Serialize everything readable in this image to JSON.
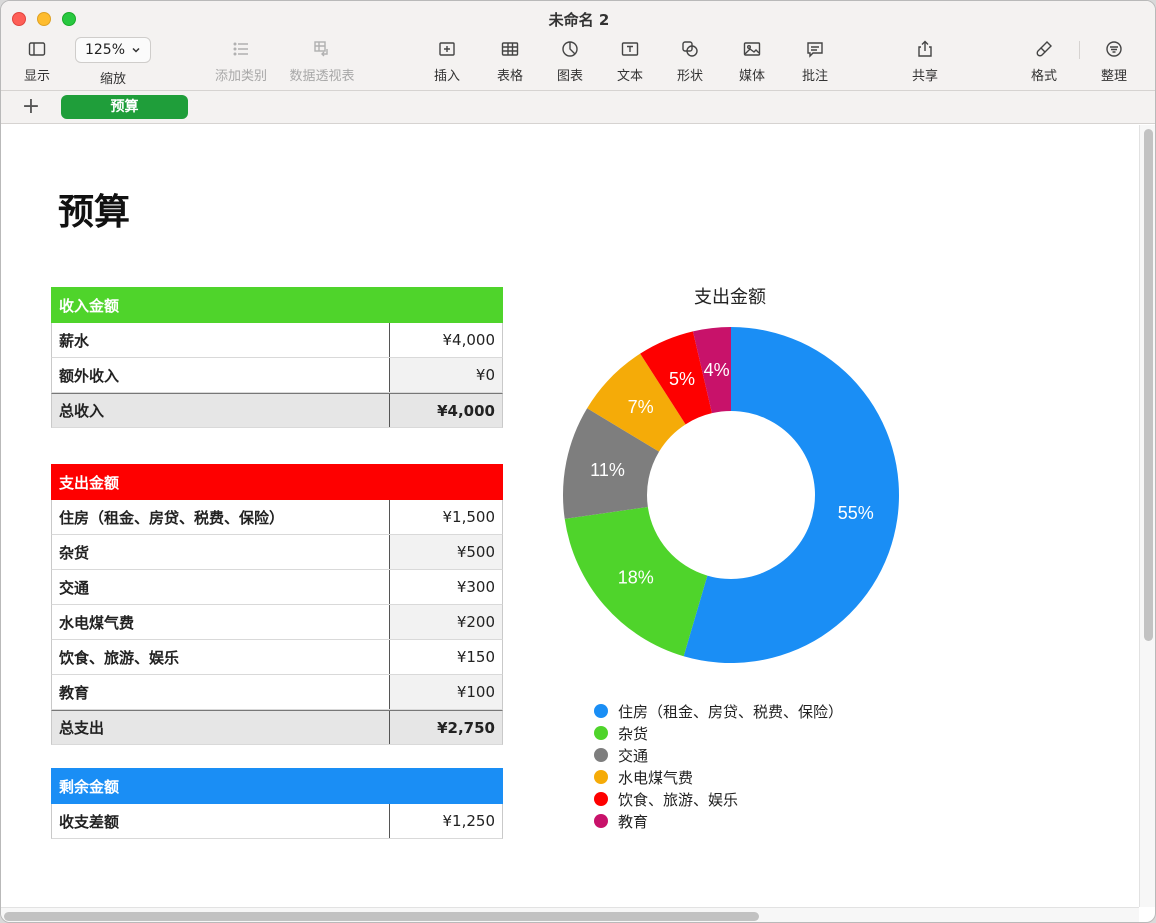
{
  "window": {
    "title": "未命名 2"
  },
  "toolbar": {
    "display_label": "显示",
    "zoom_value": "125%",
    "zoom_label": "缩放",
    "add_category_label": "添加类别",
    "pivot_label": "数据透视表",
    "insert_label": "插入",
    "table_label": "表格",
    "chart_label": "图表",
    "text_label": "文本",
    "shape_label": "形状",
    "media_label": "媒体",
    "comment_label": "批注",
    "share_label": "共享",
    "format_label": "格式",
    "organize_label": "整理"
  },
  "tabs": {
    "add": "+",
    "active": "预算"
  },
  "page": {
    "title": "预算"
  },
  "income": {
    "header": "收入金额",
    "header_color": "#4fd42b",
    "rows": [
      {
        "label": "薪水",
        "value": "¥4,000"
      },
      {
        "label": "额外收入",
        "value": "¥0"
      }
    ],
    "total": {
      "label": "总收入",
      "value": "¥4,000"
    }
  },
  "expense": {
    "header": "支出金额",
    "header_color": "#fe0000",
    "rows": [
      {
        "label": "住房（租金、房贷、税费、保险）",
        "value": "¥1,500"
      },
      {
        "label": "杂货",
        "value": "¥500"
      },
      {
        "label": "交通",
        "value": "¥300"
      },
      {
        "label": "水电煤气费",
        "value": "¥200"
      },
      {
        "label": "饮食、旅游、娱乐",
        "value": "¥150"
      },
      {
        "label": "教育",
        "value": "¥100"
      }
    ],
    "total": {
      "label": "总支出",
      "value": "¥2,750"
    }
  },
  "balance": {
    "header": "剩余金额",
    "header_color": "#1a8ef5",
    "rows": [
      {
        "label": "收支差额",
        "value": "¥1,250"
      }
    ]
  },
  "chart_data": {
    "type": "pie",
    "variant": "donut",
    "title": "支出金额",
    "categories": [
      "住房（租金、房贷、税费、保险）",
      "杂货",
      "交通",
      "水电煤气费",
      "饮食、旅游、娱乐",
      "教育"
    ],
    "values": [
      1500,
      500,
      300,
      200,
      150,
      100
    ],
    "labels": [
      "55%",
      "18%",
      "11%",
      "7%",
      "5%",
      "4%"
    ],
    "colors": [
      "#1a8ef5",
      "#4fd42b",
      "#7e7e7e",
      "#f5ab08",
      "#fe0000",
      "#c8126a"
    ],
    "legend": "bottom"
  }
}
